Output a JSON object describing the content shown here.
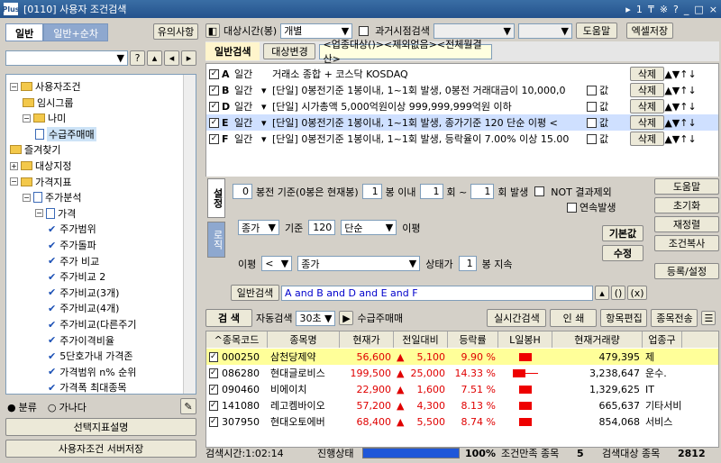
{
  "window": {
    "title": "[0110] 사용자 조건검색",
    "controls": [
      "▸",
      "1",
      "₸",
      "※",
      "?",
      "_",
      "□",
      "×"
    ]
  },
  "left": {
    "tabs": [
      "일반",
      "일반+순차"
    ],
    "help_button": "유의사항",
    "tree": [
      {
        "label": "사용자조건",
        "indent": 0,
        "icon": "folder",
        "exp": "-"
      },
      {
        "label": "임시그룹",
        "indent": 1,
        "icon": "folder",
        "exp": ""
      },
      {
        "label": "나미",
        "indent": 1,
        "icon": "folder",
        "exp": "-"
      },
      {
        "label": "수급주매매",
        "indent": 2,
        "icon": "doc",
        "exp": "",
        "selected": true
      },
      {
        "label": "즐겨찾기",
        "indent": 0,
        "icon": "folder",
        "exp": ""
      },
      {
        "label": "대상지정",
        "indent": 0,
        "icon": "folder",
        "exp": "+"
      },
      {
        "label": "가격지표",
        "indent": 0,
        "icon": "folder",
        "exp": "-"
      },
      {
        "label": "주가분석",
        "indent": 1,
        "icon": "doc",
        "exp": "-"
      },
      {
        "label": "가격",
        "indent": 2,
        "icon": "doc",
        "exp": "-"
      },
      {
        "label": "주가범위",
        "indent": 3,
        "icon": "check",
        "exp": ""
      },
      {
        "label": "주가돌파",
        "indent": 3,
        "icon": "check",
        "exp": ""
      },
      {
        "label": "주가 비교",
        "indent": 3,
        "icon": "check",
        "exp": ""
      },
      {
        "label": "주가비교 2",
        "indent": 3,
        "icon": "check",
        "exp": ""
      },
      {
        "label": "주가비교(3개)",
        "indent": 3,
        "icon": "check",
        "exp": ""
      },
      {
        "label": "주가비교(4개)",
        "indent": 3,
        "icon": "check",
        "exp": ""
      },
      {
        "label": "주가비교(다른주기",
        "indent": 3,
        "icon": "check",
        "exp": ""
      },
      {
        "label": "주가이격비율",
        "indent": 3,
        "icon": "check",
        "exp": ""
      },
      {
        "label": "5단호가내 가격존",
        "indent": 3,
        "icon": "check",
        "exp": ""
      },
      {
        "label": "가격범위 n% 순위",
        "indent": 3,
        "icon": "check",
        "exp": ""
      },
      {
        "label": "가격폭 최대종목",
        "indent": 3,
        "icon": "check",
        "exp": ""
      }
    ],
    "radio_sort": "분류",
    "radio_alpha": "가나다",
    "desc_button": "선택지표설명",
    "save_button": "사용자조건 서버저장"
  },
  "top": {
    "target_label": "대상시간(봉)",
    "target_value": "개별",
    "past_label": "과거시점검색",
    "help": "도움말",
    "excel": "엑셀저장",
    "general_search": "일반검색",
    "target_change": "대상변경",
    "target_text": "<업종대상()><제외없음><전체월결산>"
  },
  "conditions": [
    {
      "letter": "A",
      "period": "일간",
      "text": "거래소 종합 + 코스닥 KOSDAQ",
      "value_cb": false
    },
    {
      "letter": "B",
      "period": "일간",
      "text": "[단일] 0봉전기준 1봉이내, 1~1회 발생, 0봉전 거래대금이 10,000,0",
      "value_cb": true
    },
    {
      "letter": "D",
      "period": "일간",
      "text": "[단일] 시가총액 5,000억원이상 999,999,999억원 이하",
      "value_cb": true
    },
    {
      "letter": "E",
      "period": "일간",
      "text": "[단일] 0봉전기준 1봉이내, 1~1회 발생, 종가기준 120 단순 이평 <",
      "value_cb": true
    },
    {
      "letter": "F",
      "period": "일간",
      "text": "[단일] 0봉전기준 1봉이내, 1~1회 발생, 등락율이 7.00% 이상 15.00",
      "value_cb": true
    }
  ],
  "cond_labels": {
    "value": "값",
    "delete": "삭제"
  },
  "settings": {
    "tab_setting": "설정",
    "tab_logic": "로직",
    "line1": {
      "v1": "0",
      "t1": "봉전 기준(0봉은 현재봉)",
      "v2": "1",
      "t2": "봉 이내",
      "v3": "1",
      "t3": "회 ~",
      "v4": "1",
      "t4": "회 발생",
      "not": "NOT 결과제외"
    },
    "continuous": "연속발생",
    "line2": {
      "price": "종가",
      "basis": "기준",
      "n": "120",
      "ma": "단순",
      "ma_label": "이평"
    },
    "line3": {
      "label": "이평",
      "op": "<",
      "target": "종가",
      "state": "상태가",
      "n": "1",
      "persist": "봉 지속"
    },
    "default_btn": "기본값",
    "edit_btn": "수정",
    "right_buttons": [
      "도움말",
      "초기화",
      "재정렬",
      "조건복사",
      "등록/설정"
    ],
    "formula_label": "일반검색",
    "formula": "A and B and D and E and F"
  },
  "search_bar": {
    "search": "검 색",
    "auto": "자동검색",
    "interval": "30초",
    "name": "수급주매매",
    "realtime": "실시간검색",
    "print": "인 쇄",
    "edit": "항목편집",
    "transfer": "종목전송"
  },
  "results": {
    "columns": [
      "^종목코드",
      "종목명",
      "현재가",
      "전일대비",
      "등락률",
      "L일봉H",
      "현재거래량",
      "업종구"
    ],
    "rows": [
      {
        "code": "000250",
        "name": "삼천당제약",
        "price": "56,600",
        "change": "5,100",
        "rate": "9.90 %",
        "volume": "479,395",
        "sector": "제",
        "highlight": true
      },
      {
        "code": "086280",
        "name": "현대글로비스",
        "price": "199,500",
        "change": "25,000",
        "rate": "14.33 %",
        "volume": "3,238,647",
        "sector": "운수.",
        "highlight": false
      },
      {
        "code": "090460",
        "name": "비에이치",
        "price": "22,900",
        "change": "1,600",
        "rate": "7.51 %",
        "volume": "1,329,625",
        "sector": "IT",
        "highlight": false
      },
      {
        "code": "141080",
        "name": "레고켐바이오",
        "price": "57,200",
        "change": "4,300",
        "rate": "8.13 %",
        "volume": "665,637",
        "sector": "기타서비",
        "highlight": false
      },
      {
        "code": "307950",
        "name": "현대오토에버",
        "price": "68,400",
        "change": "5,500",
        "rate": "8.74 %",
        "volume": "854,068",
        "sector": "서비스",
        "highlight": false
      }
    ]
  },
  "status": {
    "time_label": "검색시간:1:02:14",
    "progress_label": "진행상태",
    "progress_pct": "100%",
    "progress_value": 1.0,
    "cond_count_label": "조건만족 종목",
    "cond_count": "5",
    "target_label": "검색대상 종목",
    "target_count": "2812"
  }
}
